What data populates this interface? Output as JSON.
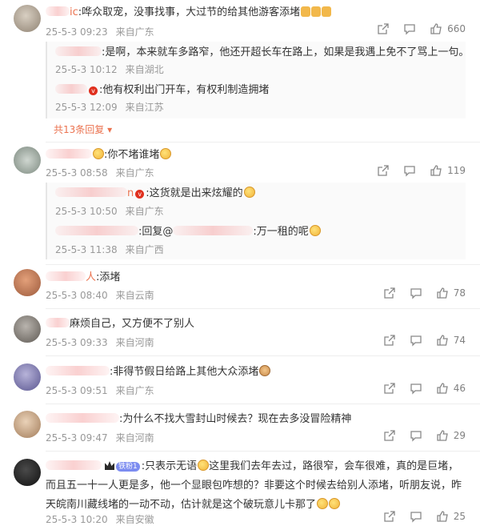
{
  "comments": [
    {
      "name_tail": "ic",
      "text": ":哗众取宠，没事找事，大过节的给其他游客添堵",
      "emoji": [
        "thumbs-down",
        "thumbs-down",
        "thumbs-down"
      ],
      "date": "25-5-3 09:23",
      "location": "来自广东",
      "likes": "660",
      "replies": [
        {
          "text": ":是啊，本来就车多路窄，他还开超长车在路上，如果是我遇上免不了骂上一句。",
          "date": "25-5-3 10:12",
          "location": "来自湖北"
        },
        {
          "text": ":他有权利出门开车，有权利制造拥堵",
          "date": "25-5-3 12:09",
          "location": "来自江苏"
        }
      ],
      "more_replies": "共13条回复"
    },
    {
      "text": ":你不堵谁堵",
      "date": "25-5-3 08:58",
      "location": "来自广东",
      "likes": "119",
      "replies": [
        {
          "name_tail": "n",
          "text": ":这货就是出来炫耀的",
          "date": "25-5-3 10:50",
          "location": "来自广东"
        },
        {
          "reply_prefix": ":回复@",
          "text": ":万一租的呢",
          "date": "25-5-3 11:38",
          "location": "来自广西"
        }
      ]
    },
    {
      "name_tail": "人",
      "text": ":添堵",
      "date": "25-5-3 08:40",
      "location": "来自云南",
      "likes": "78"
    },
    {
      "text": "麻烦自己，又方便不了别人",
      "date": "25-5-3 09:33",
      "location": "来自河南",
      "likes": "74"
    },
    {
      "text": ":非得节假日给路上其他大众添堵",
      "date": "25-5-3 09:51",
      "location": "来自广东",
      "likes": "46"
    },
    {
      "text": ":为什么不找大雪封山时候去？现在去多没冒险精神",
      "date": "25-5-3 09:47",
      "location": "来自河南",
      "likes": "29"
    },
    {
      "fan_badge": "铁粉1",
      "text": ":只表示无语",
      "text_rest": "这里我们去年去过，路很窄，会车很难，真的是巨堵，而且五一十一人更是多，他一个显眼包咋想的？非要这个时候去给别人添堵，听朋友说，昨天皖南川藏线堵的一动不动，估计就是这个破玩意儿卡那了",
      "date": "25-5-3 10:20",
      "location": "来自安徽",
      "likes": "25"
    }
  ],
  "colors": {
    "name": "#eb7350",
    "meta": "#999999",
    "action": "#808080",
    "badge": "#e0301e"
  }
}
